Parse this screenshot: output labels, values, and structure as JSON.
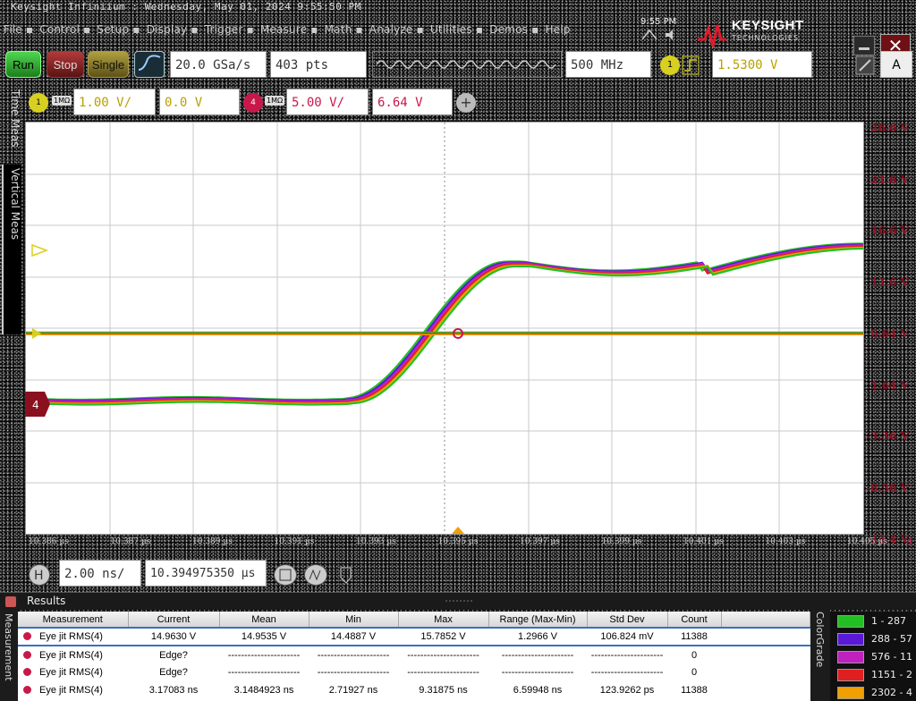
{
  "window": {
    "title": "Keysight Infiniium : Wednesday, May 01, 2024 9:55:50 PM",
    "clock": "9:55 PM",
    "brand": "KEYSIGHT",
    "brand_sub": "TECHNOLOGIES"
  },
  "menu": [
    "File",
    "Control",
    "Setup",
    "Display",
    "Trigger",
    "Measure",
    "Math",
    "Analyze",
    "Utilities",
    "Demos",
    "Help"
  ],
  "toolbar": {
    "run": "Run",
    "stop": "Stop",
    "single": "Single",
    "sample_rate": "20.0 GSa/s",
    "points": "403 pts",
    "bandwidth": "500 MHz",
    "trigger_channel": "1",
    "trigger_level": "1.5300 V"
  },
  "channels": {
    "ch1_label": "1",
    "ch1_impedance": "1MΩ",
    "ch1_scale": "1.00 V/",
    "ch1_offset": "0.0 V",
    "ch4_label": "4",
    "ch4_impedance": "1MΩ",
    "ch4_scale": "5.00 V/",
    "ch4_offset": "6.64 V"
  },
  "sidebar": {
    "time_meas": "Time Meas",
    "vertical_meas": "Vertical Meas"
  },
  "y_axis_labels": [
    "26.6 V",
    "21.6 V",
    "16.6 V",
    "11.6 V",
    "6.64 V",
    "1.64 V",
    "-3.36 V",
    "-8.36 V",
    "-13.4 V"
  ],
  "x_axis_labels": [
    "10.386 µs",
    "10.387 µs",
    "10.389 µs",
    "10.391 µs",
    "10.393 µs",
    "10.395 µs",
    "10.397 µs",
    "10.399 µs",
    "10.401 µs",
    "10.403 µs",
    "10.405 µs"
  ],
  "x_axis_end": "4",
  "timebase": {
    "scale": "2.00 ns/",
    "position": "10.394975350 µs"
  },
  "results": {
    "title": "Results",
    "side_label": "Measurement",
    "columns": [
      "Measurement",
      "Current",
      "Mean",
      "Min",
      "Max",
      "Range (Max-Min)",
      "Std Dev",
      "Count"
    ],
    "rows": [
      [
        "Eye jit RMS(4)",
        "14.9630 V",
        "14.9535 V",
        "14.4887 V",
        "15.7852 V",
        "1.2966 V",
        "106.824 mV",
        "11388"
      ],
      [
        "Eye jit RMS(4)",
        "Edge?",
        "----------------------",
        "----------------------",
        "----------------------",
        "----------------------",
        "----------------------",
        "0"
      ],
      [
        "Eye jit RMS(4)",
        "Edge?",
        "----------------------",
        "----------------------",
        "----------------------",
        "----------------------",
        "----------------------",
        "0"
      ],
      [
        "Eye jit RMS(4)",
        "3.17083 ns",
        "3.1484923 ns",
        "2.71927 ns",
        "9.31875 ns",
        "6.59948 ns",
        "123.9262 ps",
        "11388"
      ]
    ]
  },
  "color_grade": {
    "side_label": "ColorGrade",
    "levels": [
      {
        "label": "1 - 287",
        "color": "#22c022"
      },
      {
        "label": "288 - 57",
        "color": "#5a18d8"
      },
      {
        "label": "576 - 11",
        "color": "#c020c0"
      },
      {
        "label": "1151 - 2",
        "color": "#e02020"
      },
      {
        "label": "2302 - 4",
        "color": "#f0a000"
      }
    ]
  },
  "colors": {
    "ch1": "#d8d020",
    "ch4": "#c8184a",
    "axis_label": "#8a1020"
  }
}
